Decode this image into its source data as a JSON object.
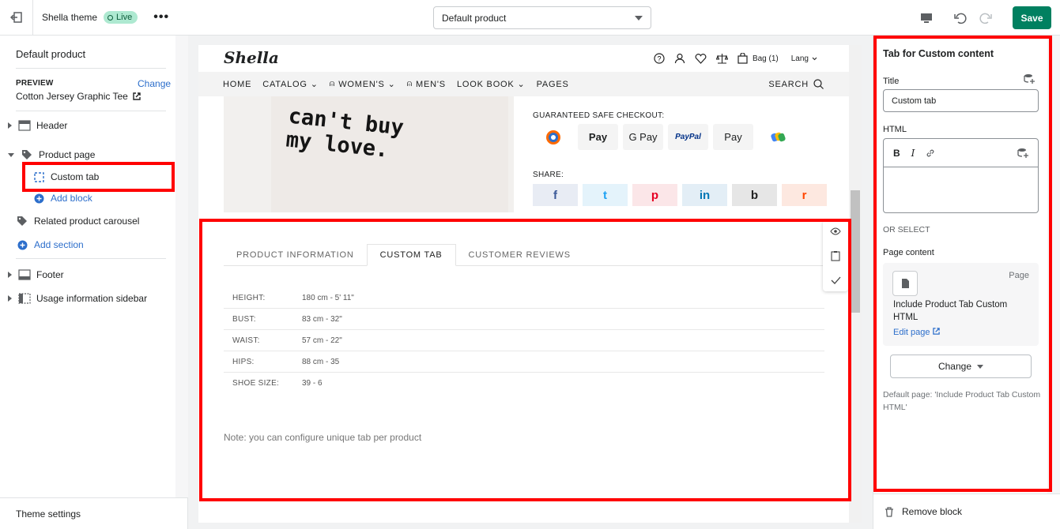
{
  "topbar": {
    "theme_name": "Shella theme",
    "live_badge": "Live",
    "more": "•••",
    "template_select": "Default product",
    "save": "Save"
  },
  "sidebar": {
    "title": "Default product",
    "preview_label": "PREVIEW",
    "preview_change": "Change",
    "preview_product": "Cotton Jersey Graphic Tee",
    "items": [
      {
        "label": "Header"
      },
      {
        "label": "Product page"
      },
      {
        "label": "Custom tab"
      },
      {
        "label": "Add block"
      },
      {
        "label": "Related product carousel"
      },
      {
        "label": "Add section"
      },
      {
        "label": "Footer"
      },
      {
        "label": "Usage information sidebar"
      }
    ],
    "footer": "Theme settings"
  },
  "shop": {
    "logo": "Shella",
    "bag": "Bag (1)",
    "lang": "Lang",
    "nav": [
      "HOME",
      "CATALOG",
      "WOMEN'S",
      "MEN'S",
      "LOOK BOOK",
      "PAGES"
    ],
    "search": "SEARCH",
    "shirt_text": "can't buy\nmy love.",
    "checkout_title": "GUARANTEED SAFE CHECKOUT:",
    "pay_methods": [
      "Pay",
      "G Pay",
      "PayPal",
      "Pay"
    ],
    "share_title": "SHARE:",
    "share": [
      "f",
      "t",
      "p",
      "in",
      "b",
      "r"
    ],
    "tabs": [
      "PRODUCT INFORMATION",
      "CUSTOM TAB",
      "CUSTOMER REVIEWS"
    ],
    "size_rows": [
      {
        "k": "HEIGHT:",
        "v": "180 cm - 5' 11\""
      },
      {
        "k": "BUST:",
        "v": "83 cm - 32\""
      },
      {
        "k": "WAIST:",
        "v": "57 cm - 22\""
      },
      {
        "k": "HIPS:",
        "v": "88 cm - 35"
      },
      {
        "k": "SHOE SIZE:",
        "v": "39 - 6"
      }
    ],
    "note": "Note: you can configure unique tab per product"
  },
  "panel": {
    "title": "Tab for Custom content",
    "title_label": "Title",
    "title_value": "Custom tab",
    "html_label": "HTML",
    "or_select": "OR SELECT",
    "page_content_label": "Page content",
    "page_tag": "Page",
    "page_name": "Include Product Tab Custom HTML",
    "edit_page": "Edit page",
    "change": "Change",
    "default_page": "Default page: 'Include Product Tab Custom HTML'",
    "remove": "Remove block"
  },
  "colors": {
    "accent": "#008060",
    "highlight": "#ff0000",
    "link": "#2c6ecb"
  }
}
